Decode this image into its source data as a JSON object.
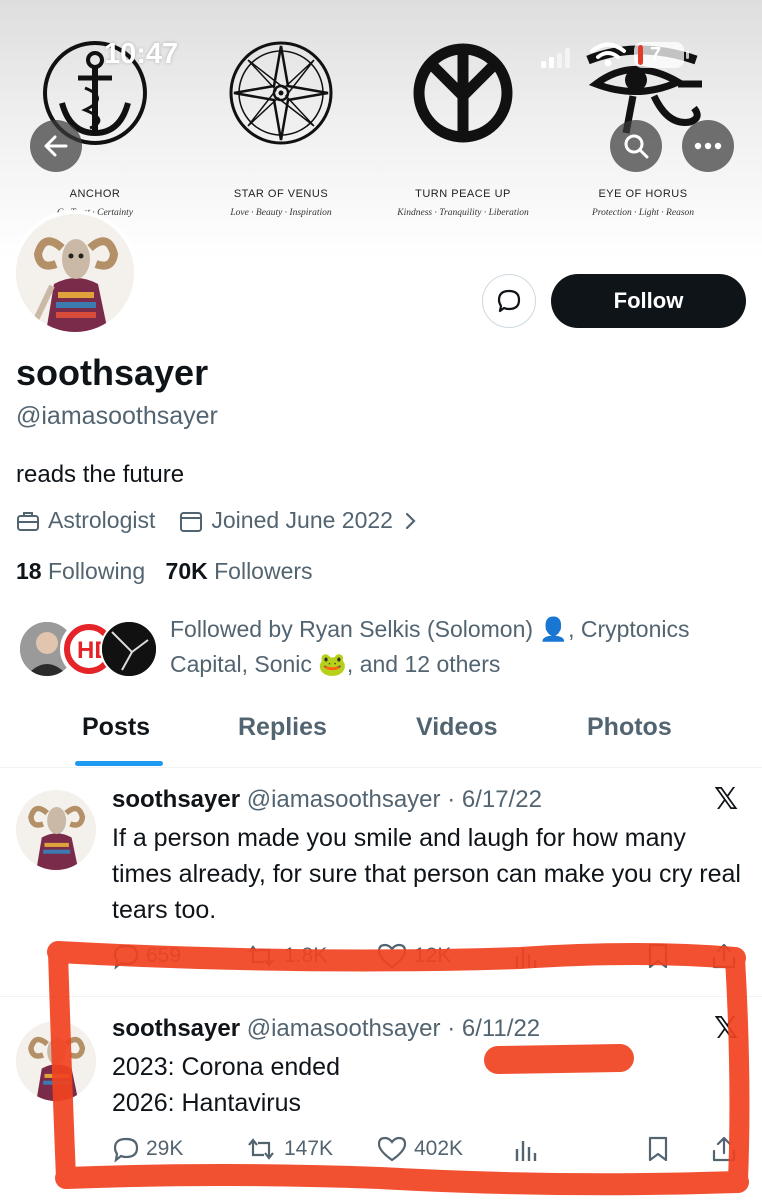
{
  "status_bar": {
    "time": "10:47",
    "battery": "7"
  },
  "banner": {
    "symbols": [
      {
        "title": "ANCHOR",
        "subtitle": "C · Trust · Certainty",
        "icon": "anchor-icon"
      },
      {
        "title": "STAR OF VENUS",
        "subtitle": "Love · Beauty · Inspiration",
        "icon": "star-compass-icon"
      },
      {
        "title": "TURN PEACE UP",
        "subtitle": "Kindness · Tranquility · Liberation",
        "icon": "inverted-peace-icon"
      },
      {
        "title": "EYE OF HORUS",
        "subtitle": "Protection · Light · Reason",
        "icon": "eye-of-horus-icon"
      }
    ]
  },
  "profile": {
    "display_name": "soothsayer",
    "handle": "@iamasoothsayer",
    "bio": "reads the future",
    "category": "Astrologist",
    "joined": "Joined June 2022",
    "following_count": "18",
    "following_label": "Following",
    "followers_count": "70K",
    "followers_label": "Followers",
    "followed_by": "Followed by Ryan Selkis (Solomon) 👤, Cryptonics Capital, Sonic 🐸, and 12 others",
    "follow_label": "Follow"
  },
  "tabs": [
    {
      "label": "Posts",
      "active": true
    },
    {
      "label": "Replies",
      "active": false
    },
    {
      "label": "Videos",
      "active": false
    },
    {
      "label": "Photos",
      "active": false
    }
  ],
  "posts": [
    {
      "name": "soothsayer",
      "handle": "@iamasoothsayer",
      "date": "· 6/17/22",
      "text": "If a person made you smile and laugh for how many times already, for sure that person can make you cry real tears too.",
      "replies": "659",
      "reposts": "1.8K",
      "likes": "12K"
    },
    {
      "name": "soothsayer",
      "handle": "@iamasoothsayer",
      "date": "· 6/11/22",
      "text_line1": "2023: Corona ended",
      "text_line2": "2026: Hantavirus",
      "replies": "29K",
      "reposts": "147K",
      "likes": "402K"
    }
  ],
  "colors": {
    "accent": "#1d9bf0",
    "text": "#0f1419",
    "muted": "#536471",
    "marker": "#f1421f"
  }
}
